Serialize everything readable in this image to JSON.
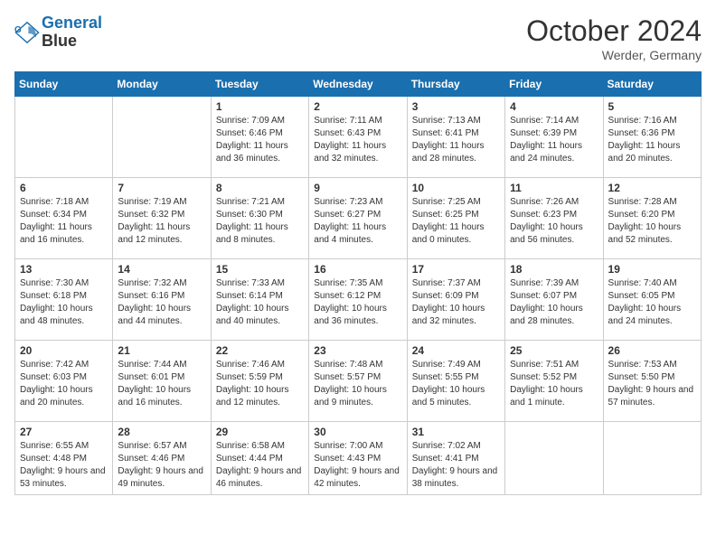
{
  "header": {
    "logo_line1": "General",
    "logo_line2": "Blue",
    "month": "October 2024",
    "location": "Werder, Germany"
  },
  "days_of_week": [
    "Sunday",
    "Monday",
    "Tuesday",
    "Wednesday",
    "Thursday",
    "Friday",
    "Saturday"
  ],
  "weeks": [
    [
      {
        "num": "",
        "sunrise": "",
        "sunset": "",
        "daylight": ""
      },
      {
        "num": "",
        "sunrise": "",
        "sunset": "",
        "daylight": ""
      },
      {
        "num": "1",
        "sunrise": "Sunrise: 7:09 AM",
        "sunset": "Sunset: 6:46 PM",
        "daylight": "Daylight: 11 hours and 36 minutes."
      },
      {
        "num": "2",
        "sunrise": "Sunrise: 7:11 AM",
        "sunset": "Sunset: 6:43 PM",
        "daylight": "Daylight: 11 hours and 32 minutes."
      },
      {
        "num": "3",
        "sunrise": "Sunrise: 7:13 AM",
        "sunset": "Sunset: 6:41 PM",
        "daylight": "Daylight: 11 hours and 28 minutes."
      },
      {
        "num": "4",
        "sunrise": "Sunrise: 7:14 AM",
        "sunset": "Sunset: 6:39 PM",
        "daylight": "Daylight: 11 hours and 24 minutes."
      },
      {
        "num": "5",
        "sunrise": "Sunrise: 7:16 AM",
        "sunset": "Sunset: 6:36 PM",
        "daylight": "Daylight: 11 hours and 20 minutes."
      }
    ],
    [
      {
        "num": "6",
        "sunrise": "Sunrise: 7:18 AM",
        "sunset": "Sunset: 6:34 PM",
        "daylight": "Daylight: 11 hours and 16 minutes."
      },
      {
        "num": "7",
        "sunrise": "Sunrise: 7:19 AM",
        "sunset": "Sunset: 6:32 PM",
        "daylight": "Daylight: 11 hours and 12 minutes."
      },
      {
        "num": "8",
        "sunrise": "Sunrise: 7:21 AM",
        "sunset": "Sunset: 6:30 PM",
        "daylight": "Daylight: 11 hours and 8 minutes."
      },
      {
        "num": "9",
        "sunrise": "Sunrise: 7:23 AM",
        "sunset": "Sunset: 6:27 PM",
        "daylight": "Daylight: 11 hours and 4 minutes."
      },
      {
        "num": "10",
        "sunrise": "Sunrise: 7:25 AM",
        "sunset": "Sunset: 6:25 PM",
        "daylight": "Daylight: 11 hours and 0 minutes."
      },
      {
        "num": "11",
        "sunrise": "Sunrise: 7:26 AM",
        "sunset": "Sunset: 6:23 PM",
        "daylight": "Daylight: 10 hours and 56 minutes."
      },
      {
        "num": "12",
        "sunrise": "Sunrise: 7:28 AM",
        "sunset": "Sunset: 6:20 PM",
        "daylight": "Daylight: 10 hours and 52 minutes."
      }
    ],
    [
      {
        "num": "13",
        "sunrise": "Sunrise: 7:30 AM",
        "sunset": "Sunset: 6:18 PM",
        "daylight": "Daylight: 10 hours and 48 minutes."
      },
      {
        "num": "14",
        "sunrise": "Sunrise: 7:32 AM",
        "sunset": "Sunset: 6:16 PM",
        "daylight": "Daylight: 10 hours and 44 minutes."
      },
      {
        "num": "15",
        "sunrise": "Sunrise: 7:33 AM",
        "sunset": "Sunset: 6:14 PM",
        "daylight": "Daylight: 10 hours and 40 minutes."
      },
      {
        "num": "16",
        "sunrise": "Sunrise: 7:35 AM",
        "sunset": "Sunset: 6:12 PM",
        "daylight": "Daylight: 10 hours and 36 minutes."
      },
      {
        "num": "17",
        "sunrise": "Sunrise: 7:37 AM",
        "sunset": "Sunset: 6:09 PM",
        "daylight": "Daylight: 10 hours and 32 minutes."
      },
      {
        "num": "18",
        "sunrise": "Sunrise: 7:39 AM",
        "sunset": "Sunset: 6:07 PM",
        "daylight": "Daylight: 10 hours and 28 minutes."
      },
      {
        "num": "19",
        "sunrise": "Sunrise: 7:40 AM",
        "sunset": "Sunset: 6:05 PM",
        "daylight": "Daylight: 10 hours and 24 minutes."
      }
    ],
    [
      {
        "num": "20",
        "sunrise": "Sunrise: 7:42 AM",
        "sunset": "Sunset: 6:03 PM",
        "daylight": "Daylight: 10 hours and 20 minutes."
      },
      {
        "num": "21",
        "sunrise": "Sunrise: 7:44 AM",
        "sunset": "Sunset: 6:01 PM",
        "daylight": "Daylight: 10 hours and 16 minutes."
      },
      {
        "num": "22",
        "sunrise": "Sunrise: 7:46 AM",
        "sunset": "Sunset: 5:59 PM",
        "daylight": "Daylight: 10 hours and 12 minutes."
      },
      {
        "num": "23",
        "sunrise": "Sunrise: 7:48 AM",
        "sunset": "Sunset: 5:57 PM",
        "daylight": "Daylight: 10 hours and 9 minutes."
      },
      {
        "num": "24",
        "sunrise": "Sunrise: 7:49 AM",
        "sunset": "Sunset: 5:55 PM",
        "daylight": "Daylight: 10 hours and 5 minutes."
      },
      {
        "num": "25",
        "sunrise": "Sunrise: 7:51 AM",
        "sunset": "Sunset: 5:52 PM",
        "daylight": "Daylight: 10 hours and 1 minute."
      },
      {
        "num": "26",
        "sunrise": "Sunrise: 7:53 AM",
        "sunset": "Sunset: 5:50 PM",
        "daylight": "Daylight: 9 hours and 57 minutes."
      }
    ],
    [
      {
        "num": "27",
        "sunrise": "Sunrise: 6:55 AM",
        "sunset": "Sunset: 4:48 PM",
        "daylight": "Daylight: 9 hours and 53 minutes."
      },
      {
        "num": "28",
        "sunrise": "Sunrise: 6:57 AM",
        "sunset": "Sunset: 4:46 PM",
        "daylight": "Daylight: 9 hours and 49 minutes."
      },
      {
        "num": "29",
        "sunrise": "Sunrise: 6:58 AM",
        "sunset": "Sunset: 4:44 PM",
        "daylight": "Daylight: 9 hours and 46 minutes."
      },
      {
        "num": "30",
        "sunrise": "Sunrise: 7:00 AM",
        "sunset": "Sunset: 4:43 PM",
        "daylight": "Daylight: 9 hours and 42 minutes."
      },
      {
        "num": "31",
        "sunrise": "Sunrise: 7:02 AM",
        "sunset": "Sunset: 4:41 PM",
        "daylight": "Daylight: 9 hours and 38 minutes."
      },
      {
        "num": "",
        "sunrise": "",
        "sunset": "",
        "daylight": ""
      },
      {
        "num": "",
        "sunrise": "",
        "sunset": "",
        "daylight": ""
      }
    ]
  ]
}
